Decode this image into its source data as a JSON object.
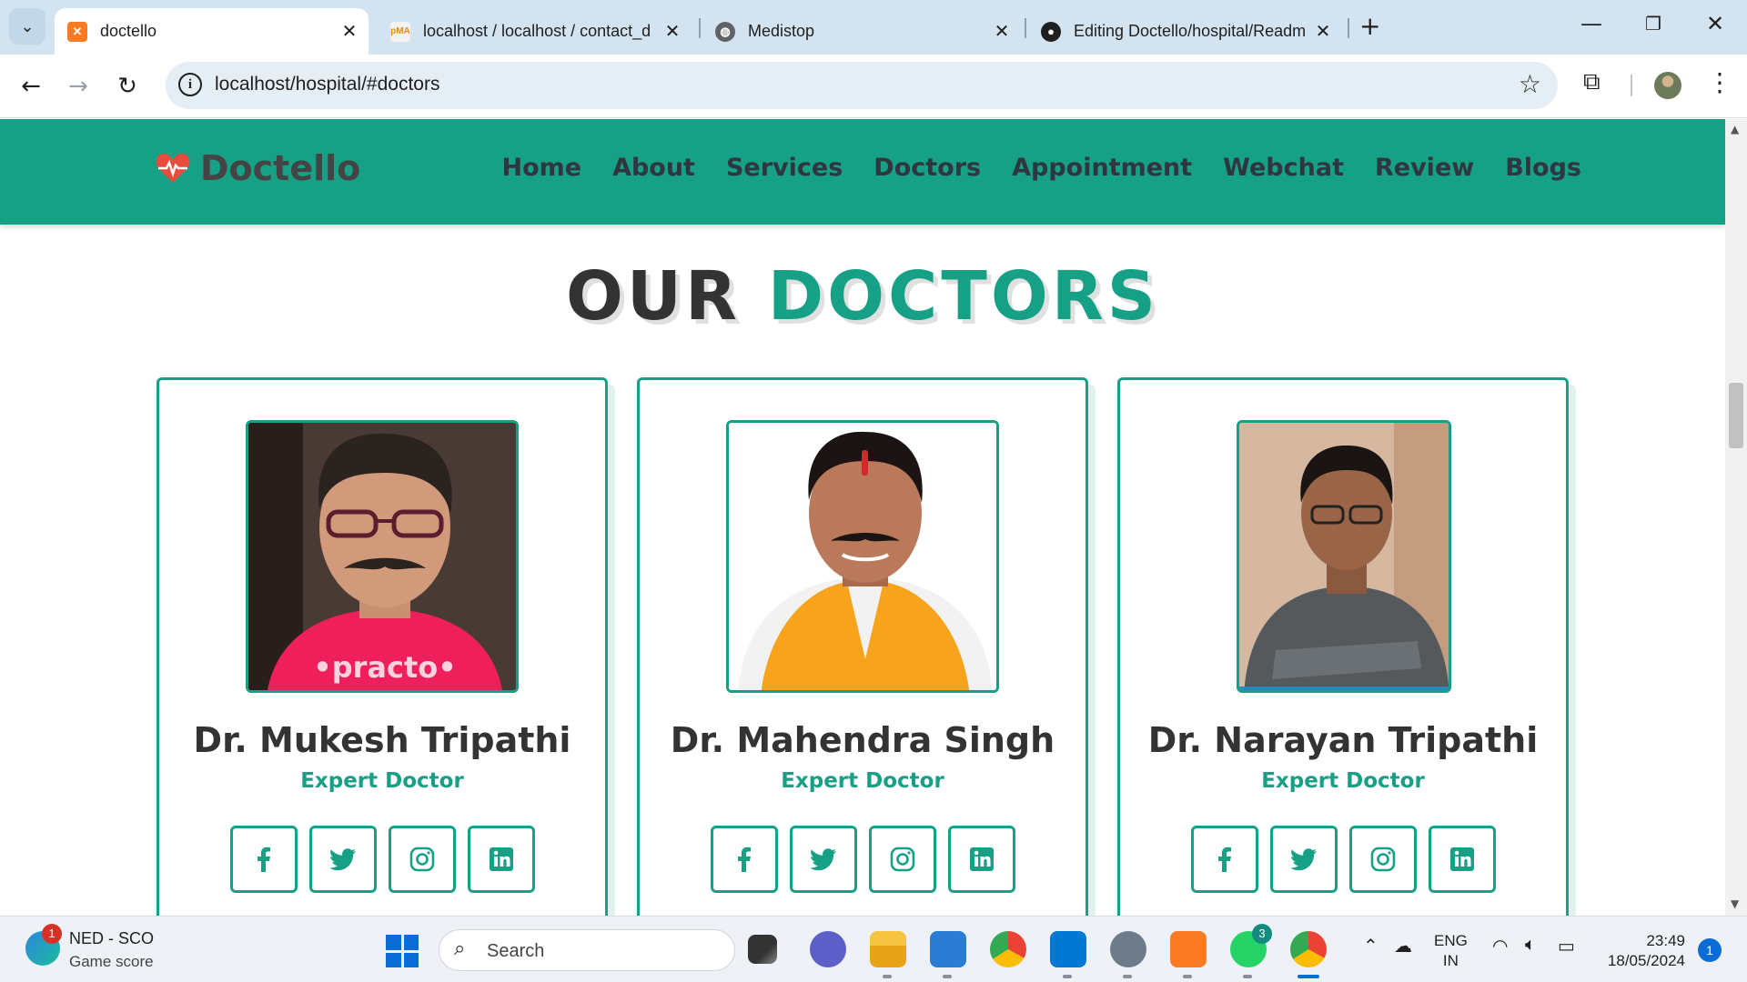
{
  "browser": {
    "tabs": [
      {
        "title": "doctello",
        "favicon": "xampp-icon",
        "active": true
      },
      {
        "title": "localhost / localhost / contact_d",
        "favicon": "phpmyadmin-icon",
        "active": false
      },
      {
        "title": "Medistop",
        "favicon": "globe-icon",
        "active": false
      },
      {
        "title": "Editing Doctello/hospital/Readm",
        "favicon": "github-icon",
        "active": false
      }
    ],
    "url": "localhost/hospital/#doctors"
  },
  "site": {
    "brand": "Doctello",
    "nav": [
      "Home",
      "About",
      "Services",
      "Doctors",
      "Appointment",
      "Webchat",
      "Review",
      "Blogs"
    ],
    "heading": {
      "word1": "OUR",
      "word2": "DOCTORS"
    },
    "doctors": [
      {
        "name": "Dr. Mukesh Tripathi",
        "role": "Expert Doctor",
        "photo_watermark": "•practo•"
      },
      {
        "name": "Dr. Mahendra Singh",
        "role": "Expert Doctor"
      },
      {
        "name": "Dr. Narayan Tripathi",
        "role": "Expert Doctor"
      }
    ],
    "socials": [
      "facebook-icon",
      "twitter-icon",
      "instagram-icon",
      "linkedin-icon"
    ],
    "colors": {
      "accent": "#16a085",
      "text": "#333333"
    }
  },
  "taskbar": {
    "widget_title": "NED - SCO",
    "widget_subtitle": "Game score",
    "widget_badge": "1",
    "search_label": "Search",
    "whatsapp_badge": "3",
    "lang_line1": "ENG",
    "lang_line2": "IN",
    "time": "23:49",
    "date": "18/05/2024",
    "notification_count": "1"
  }
}
